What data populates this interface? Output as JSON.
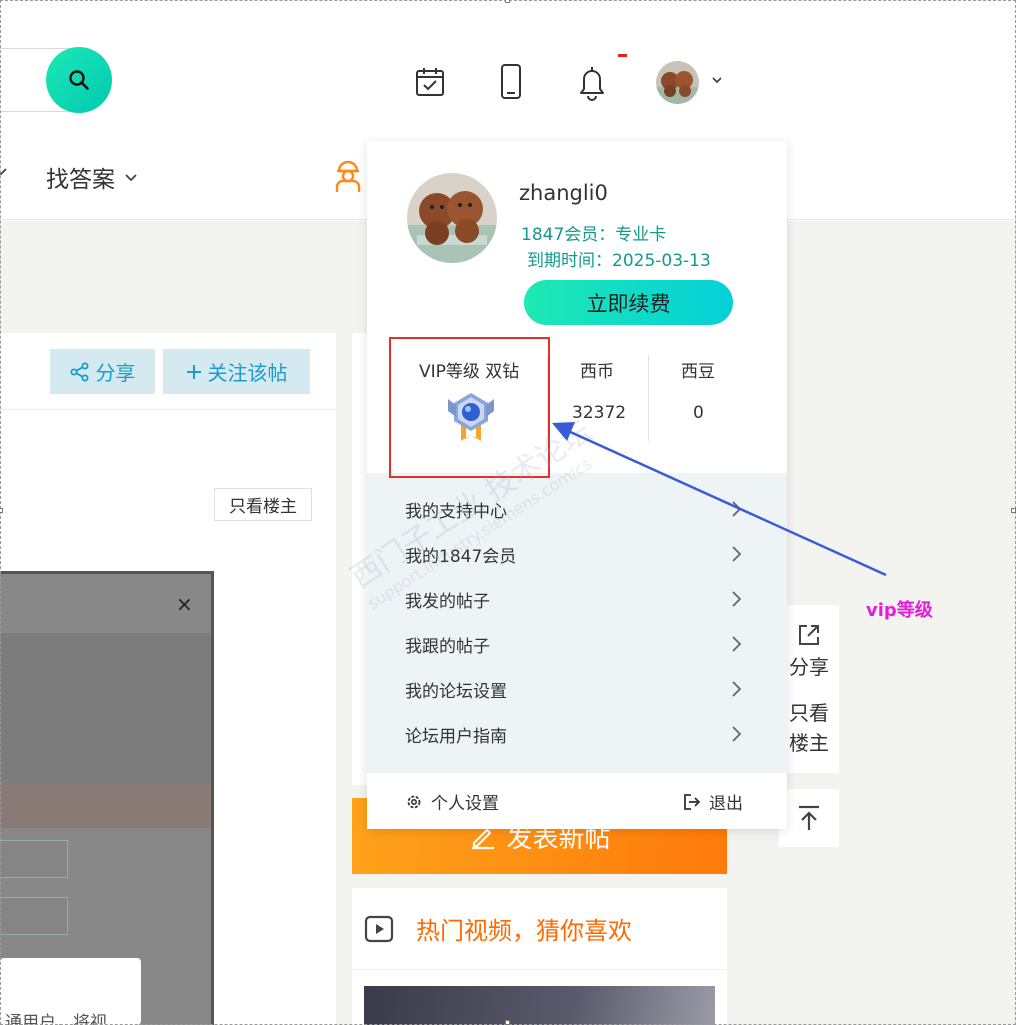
{
  "header": {
    "nav_find_answer": "找答案"
  },
  "post": {
    "share_label": "分享",
    "follow_label": "关注该帖",
    "only_owner_label": "只看楼主"
  },
  "modal": {
    "close_symbol": "×",
    "bottom_text": "通用户，将视"
  },
  "sidebar": {
    "post_new_label": "发表新帖",
    "hot_video_title": "热门视频，猜你喜欢"
  },
  "side_float": {
    "share_label": "分享",
    "only_owner_label": "只看楼主"
  },
  "user_popup": {
    "username": "zhangli0",
    "member_line": "1847会员：专业卡",
    "expiry_line": "到期时间：2025-03-13",
    "renew_label": "立即续费",
    "vip_label": "VIP等级 双钻",
    "coin_label": "西币",
    "coin_value": "32372",
    "bean_label": "西豆",
    "bean_value": "0",
    "menu": [
      {
        "label": "我的支持中心"
      },
      {
        "label": "我的1847会员"
      },
      {
        "label": "我发的帖子"
      },
      {
        "label": "我跟的帖子"
      },
      {
        "label": "我的论坛设置"
      },
      {
        "label": "论坛用户指南"
      }
    ],
    "settings_label": "个人设置",
    "logout_label": "退出"
  },
  "annotation": {
    "text": "vip等级",
    "color": "#e020d8",
    "arrow_color": "#3a5bd6",
    "highlight_color": "#e03030"
  },
  "watermark": {
    "line1": "西门子工业 技术论坛",
    "line2": "support.industry.siemens.com/cs"
  },
  "colors": {
    "accent_teal": "#1de9b6",
    "member_text": "#139a8c",
    "link_blue": "#1a9ccc",
    "orange": "#ff7a0a"
  }
}
